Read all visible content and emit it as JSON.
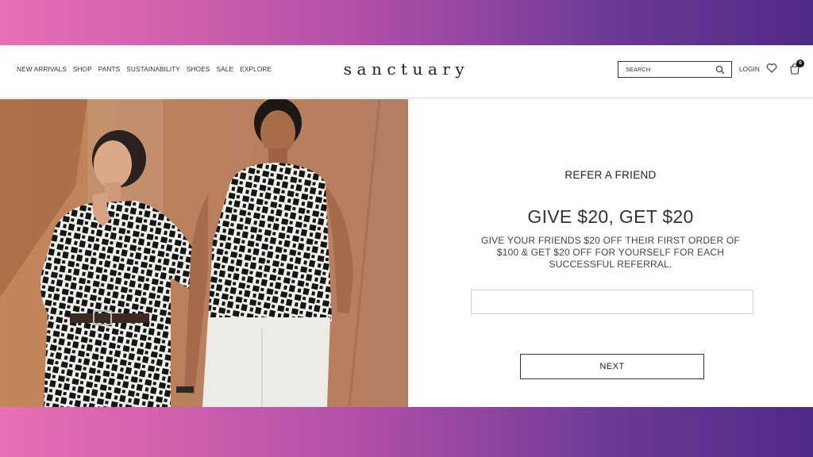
{
  "header": {
    "nav": [
      "NEW ARRIVALS",
      "SHOP",
      "PANTS",
      "SUSTAINABILITY",
      "SHOES",
      "SALE",
      "EXPLORE"
    ],
    "logo": "sanctuary",
    "search_placeholder": "SEARCH",
    "login": "LOGIN",
    "bag_count": "0",
    "icons": {
      "search": "search-icon",
      "wishlist": "heart-icon",
      "bag": "shopping-bag-icon"
    }
  },
  "hero": {
    "image": "two-models-in-black-white-geometric-print-tops"
  },
  "referral": {
    "kicker": "REFER A FRIEND",
    "headline": "GIVE $20, GET $20",
    "body": "GIVE YOUR FRIENDS $20 OFF THEIR FIRST ORDER OF $100 & GET $20 OFF FOR YOURSELF FOR EACH SUCCESSFUL REFERRAL.",
    "email_value": "",
    "next_label": "NEXT"
  },
  "colors": {
    "gradient_start": "#ea6fb4",
    "gradient_end": "#4f2a86",
    "text": "#333333",
    "border": "#cfcfcf"
  }
}
